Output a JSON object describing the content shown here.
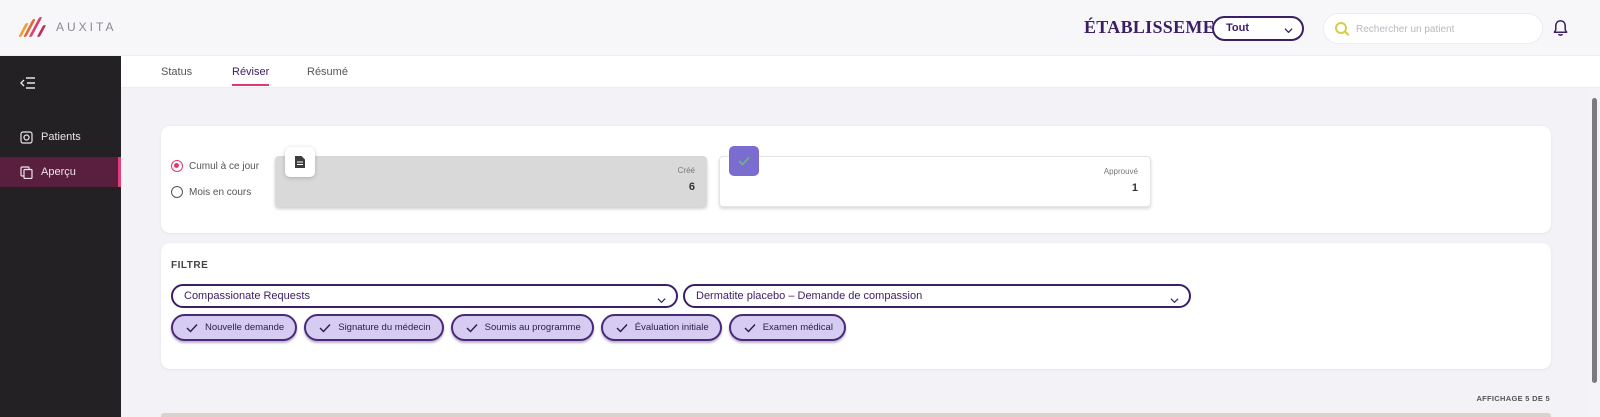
{
  "app": {
    "logo_text": "AUXITA"
  },
  "header": {
    "etablissement_label": "ÉTABLISSEMENT",
    "etablissement_value": "Tout",
    "search_placeholder": "Rechercher un patient"
  },
  "sidebar": {
    "items": [
      {
        "label": "Patients",
        "icon": "patients-icon",
        "active": false
      },
      {
        "label": "Aperçu",
        "icon": "overview-icon",
        "active": true
      }
    ]
  },
  "tabs": [
    {
      "label": "Status",
      "active": false
    },
    {
      "label": "Réviser",
      "active": true
    },
    {
      "label": "Résumé",
      "active": false
    }
  ],
  "stats": {
    "period_options": [
      {
        "label": "Cumul à ce jour",
        "checked": true
      },
      {
        "label": "Mois en cours",
        "checked": false
      }
    ],
    "cards": [
      {
        "label": "Créé",
        "value": "6",
        "icon": "document-icon"
      },
      {
        "label": "Approuvé",
        "value": "1",
        "icon": "check-icon"
      }
    ]
  },
  "filter": {
    "title": "FILTRE",
    "program_select": "Compassionate Requests",
    "request_select": "Dermatite placebo – Demande de compassion",
    "chips": [
      "Nouvelle demande",
      "Signature du médecin",
      "Soumis au programme",
      "Évaluation initiale",
      "Examen médical"
    ]
  },
  "table": {
    "showing_text": "AFFICHAGE 5 DE 5"
  },
  "colors": {
    "brand_purple": "#3b1e63",
    "accent_pink": "#e03a6e",
    "chip_fill": "#d6ccf2",
    "sidebar_bg": "#232123",
    "sidebar_active": "#5a1f3e",
    "approved_icon": "#7b6cd0"
  }
}
